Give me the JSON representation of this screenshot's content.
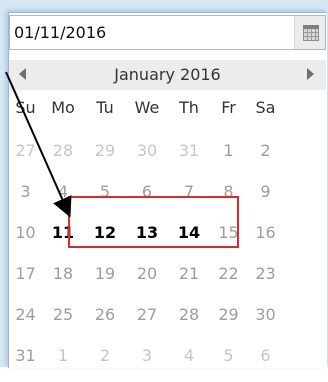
{
  "date_field": {
    "value": "01/11/2016"
  },
  "calendar": {
    "month_title": "January 2016",
    "weekdays": [
      "Su",
      "Mo",
      "Tu",
      "We",
      "Th",
      "Fr",
      "Sa"
    ],
    "weeks": [
      [
        "27",
        "28",
        "29",
        "30",
        "31",
        "1",
        "2"
      ],
      [
        "3",
        "4",
        "5",
        "6",
        "7",
        "8",
        "9"
      ],
      [
        "10",
        "11",
        "12",
        "13",
        "14",
        "15",
        "16"
      ],
      [
        "17",
        "18",
        "19",
        "20",
        "21",
        "22",
        "23"
      ],
      [
        "24",
        "25",
        "26",
        "27",
        "28",
        "29",
        "30"
      ],
      [
        "31",
        "1",
        "2",
        "3",
        "4",
        "5",
        "6"
      ]
    ],
    "selected_day": "11",
    "highlighted_range": [
      "12",
      "13",
      "14"
    ]
  },
  "colors": {
    "highlight_border": "#dc2a2a",
    "selected_bg": "#d9d9d9",
    "outside_month_text": "#c6c6c6",
    "in_month_text": "#9d9d9d"
  },
  "icons": {
    "calendar_button": "calendar-icon",
    "prev_month": "chevron-left-icon",
    "next_month": "chevron-right-icon",
    "annotation": "arrow-icon"
  }
}
